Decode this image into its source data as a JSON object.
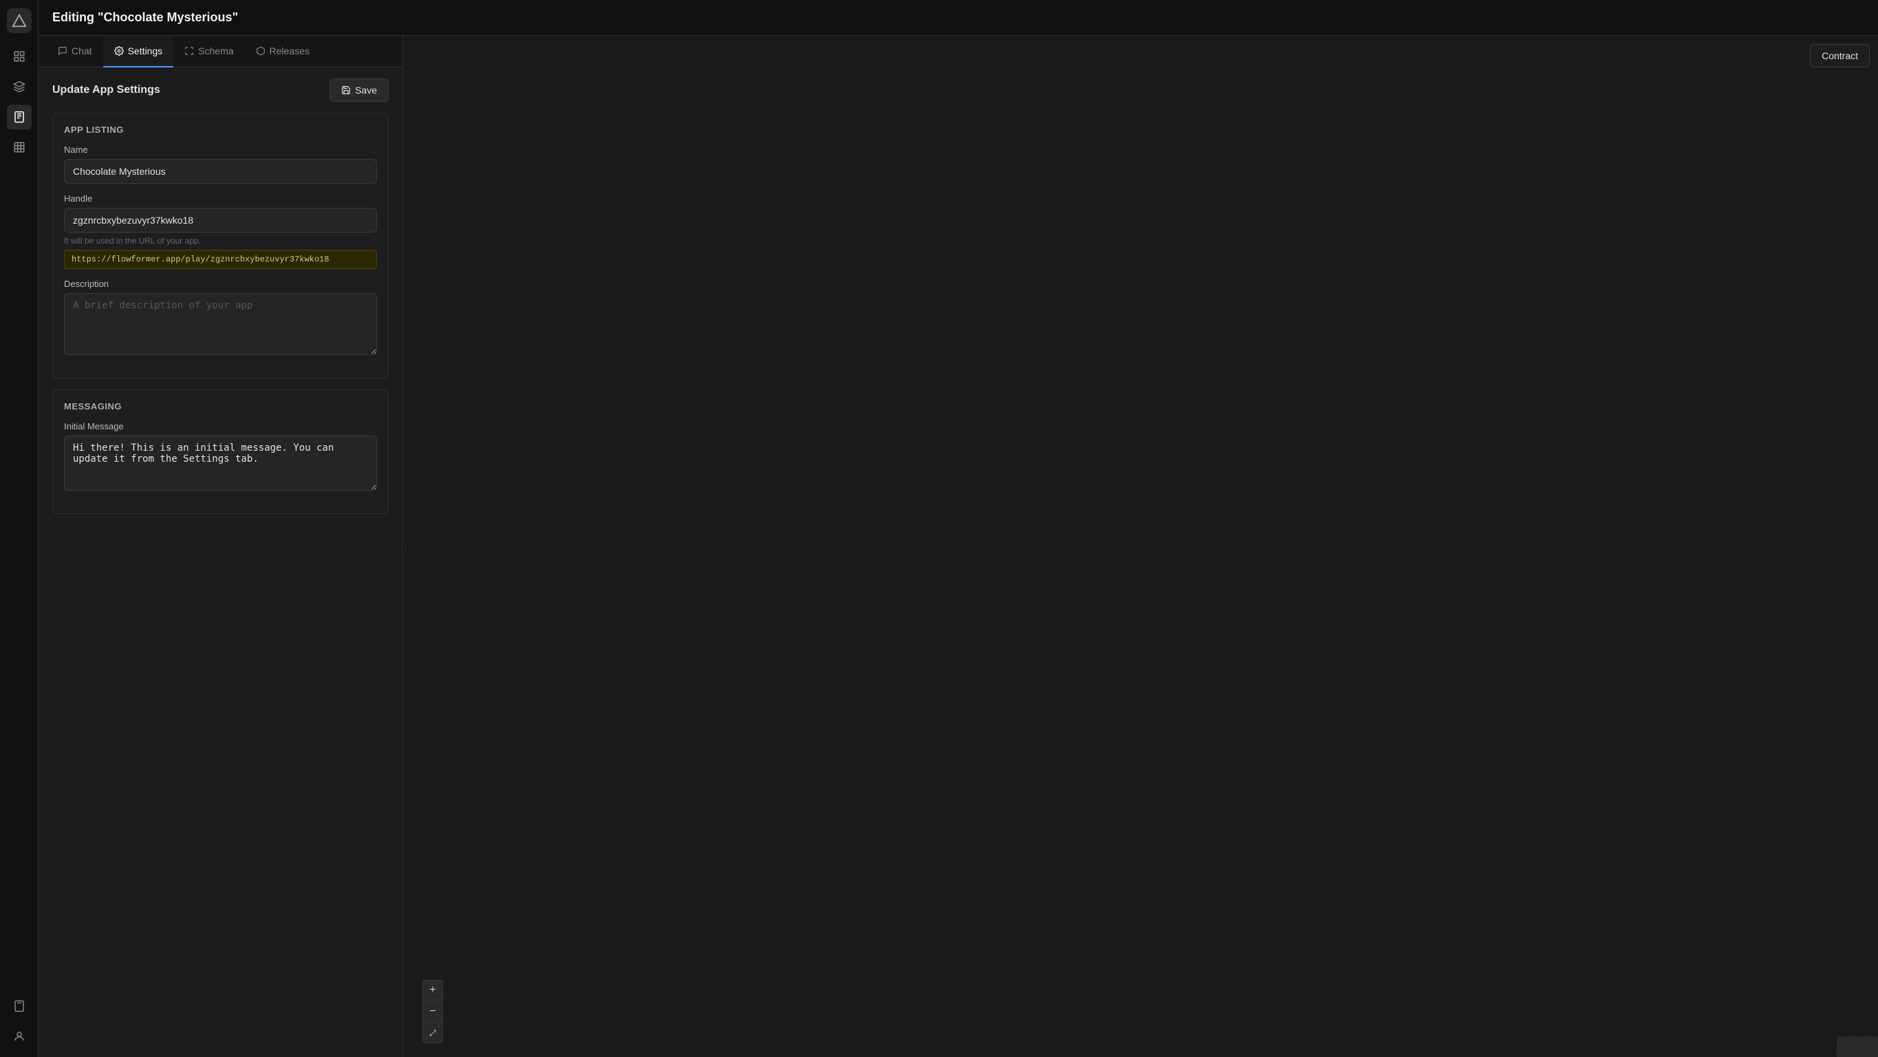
{
  "header": {
    "title": "Editing \"Chocolate Mysterious\""
  },
  "tabs": [
    {
      "id": "chat",
      "label": "Chat",
      "active": false
    },
    {
      "id": "settings",
      "label": "Settings",
      "active": true
    },
    {
      "id": "schema",
      "label": "Schema",
      "active": false
    },
    {
      "id": "releases",
      "label": "Releases",
      "active": false
    }
  ],
  "panel": {
    "update_title": "Update App Settings",
    "save_label": "Save",
    "app_listing": {
      "section_title": "App Listing",
      "name_label": "Name",
      "name_value": "Chocolate Mysterious",
      "handle_label": "Handle",
      "handle_value": "zgznrcbxybezuvyr37kwko18",
      "handle_hint": "It will be used in the URL of your app.",
      "handle_url": "https://flowformer.app/play/zgznrcbxybezuvyr37kwko18",
      "description_label": "Description",
      "description_placeholder": "A brief description of your app"
    },
    "messaging": {
      "section_title": "Messaging",
      "initial_message_label": "Initial Message",
      "initial_message_value": "Hi there! This is an initial message. You can update it from the Settings tab."
    }
  },
  "canvas": {
    "contract_label": "Contract"
  },
  "zoom": {
    "plus": "+",
    "minus": "−",
    "fit": "⤢"
  },
  "sidebar": {
    "logo_icon": "triangle-icon",
    "items": [
      {
        "id": "grid",
        "icon": "grid-icon",
        "active": false
      },
      {
        "id": "layers",
        "icon": "layers-icon",
        "active": false
      },
      {
        "id": "document",
        "icon": "document-icon",
        "active": true
      },
      {
        "id": "table",
        "icon": "table-icon",
        "active": false
      }
    ],
    "bottom_items": [
      {
        "id": "page",
        "icon": "page-icon"
      },
      {
        "id": "user",
        "icon": "user-icon"
      }
    ]
  }
}
